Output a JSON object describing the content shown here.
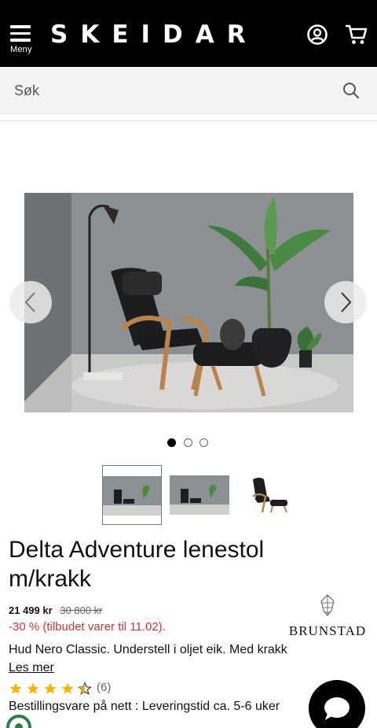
{
  "header": {
    "logo": "SKEIDAR",
    "menu_label": "Meny",
    "icons": {
      "menu": "hamburger-icon",
      "user": "user-circle-icon",
      "cart": "cart-icon"
    }
  },
  "search": {
    "placeholder": "Søk",
    "icon": "search-icon"
  },
  "gallery": {
    "images": [
      "Delta Adventure lenestol i lounge-miljø",
      "Delta Adventure lenestol i lounge-miljø",
      "Delta Adventure lenestol med krakk"
    ],
    "active_index": 0,
    "dot_count": 3
  },
  "product": {
    "title": "Delta Adventure lenestol m/krakk",
    "price": "21 499 kr",
    "old_price": "30 800 kr",
    "discount": "-30 % (tilbudet varer til 11.02).",
    "brand": "BRUNSTAD",
    "description": "Hud Nero Classic. Understell i oljet eik. Med krakk",
    "read_more": "Les mer",
    "rating": 4.5,
    "rating_max": 5,
    "review_count": "(6)",
    "delivery": "Bestillingsvare på nett : Leveringstid ca. 5-6 uker"
  },
  "colors": {
    "header_bg": "#000000",
    "discount": "#d43232",
    "star": "#f5b400",
    "search_bg": "#f4f4f4"
  }
}
